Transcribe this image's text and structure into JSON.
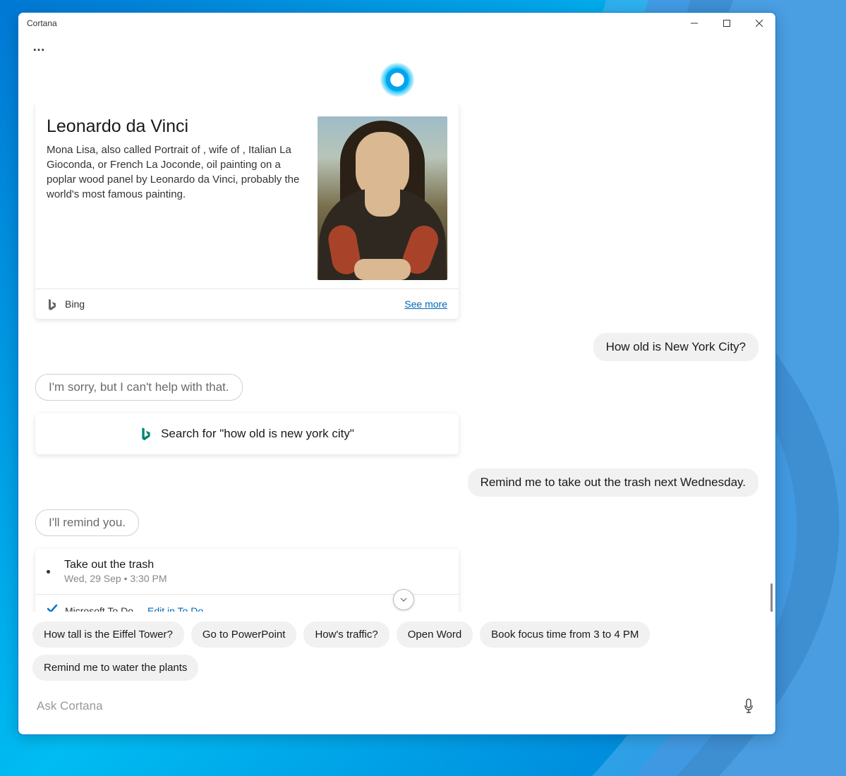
{
  "window": {
    "title": "Cortana"
  },
  "card_info": {
    "title": "Leonardo da Vinci",
    "description": "Mona Lisa, also called Portrait of , wife of , Italian La Gioconda, or French La Joconde, oil painting on a poplar wood panel by Leonardo da Vinci, probably the world's most famous painting.",
    "source": "Bing",
    "see_more": "See more"
  },
  "conversation": {
    "user1": "How old is New York City?",
    "assistant1": "I'm sorry, but I can't help with that.",
    "search_card": "Search for \"how old is new york city\"",
    "user2": "Remind me to take out the trash next Wednesday.",
    "assistant2": "I'll remind you."
  },
  "reminder": {
    "title": "Take out the trash",
    "time": "Wed, 29 Sep • 3:30 PM",
    "source": "Microsoft To Do",
    "edit_link": "Edit in To Do"
  },
  "chips": [
    "How tall is the Eiffel Tower?",
    "Go to PowerPoint",
    "How's traffic?",
    "Open Word",
    "Book focus time from 3 to 4 PM",
    "Remind me to water the plants"
  ],
  "input": {
    "placeholder": "Ask Cortana"
  }
}
